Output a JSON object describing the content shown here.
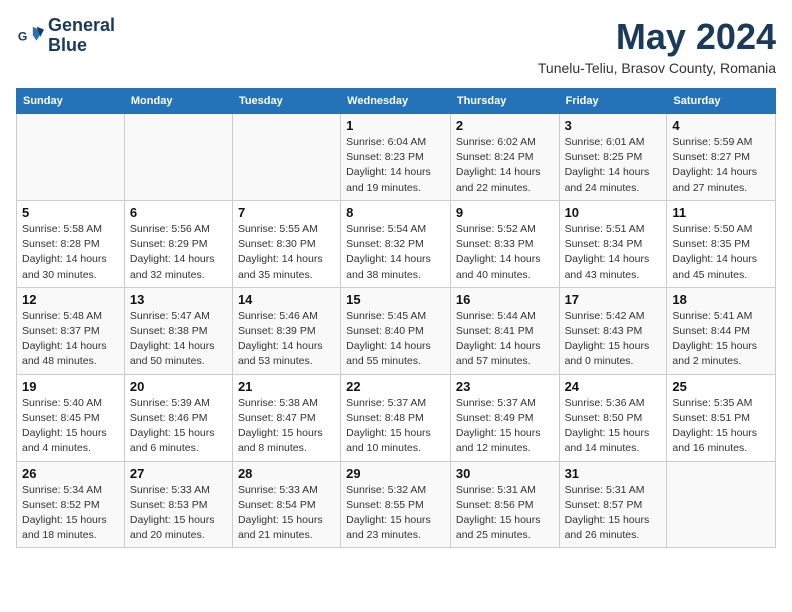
{
  "header": {
    "logo_line1": "General",
    "logo_line2": "Blue",
    "month": "May 2024",
    "location": "Tunelu-Teliu, Brasov County, Romania"
  },
  "weekdays": [
    "Sunday",
    "Monday",
    "Tuesday",
    "Wednesday",
    "Thursday",
    "Friday",
    "Saturday"
  ],
  "weeks": [
    [
      {
        "day": "",
        "info": ""
      },
      {
        "day": "",
        "info": ""
      },
      {
        "day": "",
        "info": ""
      },
      {
        "day": "1",
        "info": "Sunrise: 6:04 AM\nSunset: 8:23 PM\nDaylight: 14 hours\nand 19 minutes."
      },
      {
        "day": "2",
        "info": "Sunrise: 6:02 AM\nSunset: 8:24 PM\nDaylight: 14 hours\nand 22 minutes."
      },
      {
        "day": "3",
        "info": "Sunrise: 6:01 AM\nSunset: 8:25 PM\nDaylight: 14 hours\nand 24 minutes."
      },
      {
        "day": "4",
        "info": "Sunrise: 5:59 AM\nSunset: 8:27 PM\nDaylight: 14 hours\nand 27 minutes."
      }
    ],
    [
      {
        "day": "5",
        "info": "Sunrise: 5:58 AM\nSunset: 8:28 PM\nDaylight: 14 hours\nand 30 minutes."
      },
      {
        "day": "6",
        "info": "Sunrise: 5:56 AM\nSunset: 8:29 PM\nDaylight: 14 hours\nand 32 minutes."
      },
      {
        "day": "7",
        "info": "Sunrise: 5:55 AM\nSunset: 8:30 PM\nDaylight: 14 hours\nand 35 minutes."
      },
      {
        "day": "8",
        "info": "Sunrise: 5:54 AM\nSunset: 8:32 PM\nDaylight: 14 hours\nand 38 minutes."
      },
      {
        "day": "9",
        "info": "Sunrise: 5:52 AM\nSunset: 8:33 PM\nDaylight: 14 hours\nand 40 minutes."
      },
      {
        "day": "10",
        "info": "Sunrise: 5:51 AM\nSunset: 8:34 PM\nDaylight: 14 hours\nand 43 minutes."
      },
      {
        "day": "11",
        "info": "Sunrise: 5:50 AM\nSunset: 8:35 PM\nDaylight: 14 hours\nand 45 minutes."
      }
    ],
    [
      {
        "day": "12",
        "info": "Sunrise: 5:48 AM\nSunset: 8:37 PM\nDaylight: 14 hours\nand 48 minutes."
      },
      {
        "day": "13",
        "info": "Sunrise: 5:47 AM\nSunset: 8:38 PM\nDaylight: 14 hours\nand 50 minutes."
      },
      {
        "day": "14",
        "info": "Sunrise: 5:46 AM\nSunset: 8:39 PM\nDaylight: 14 hours\nand 53 minutes."
      },
      {
        "day": "15",
        "info": "Sunrise: 5:45 AM\nSunset: 8:40 PM\nDaylight: 14 hours\nand 55 minutes."
      },
      {
        "day": "16",
        "info": "Sunrise: 5:44 AM\nSunset: 8:41 PM\nDaylight: 14 hours\nand 57 minutes."
      },
      {
        "day": "17",
        "info": "Sunrise: 5:42 AM\nSunset: 8:43 PM\nDaylight: 15 hours\nand 0 minutes."
      },
      {
        "day": "18",
        "info": "Sunrise: 5:41 AM\nSunset: 8:44 PM\nDaylight: 15 hours\nand 2 minutes."
      }
    ],
    [
      {
        "day": "19",
        "info": "Sunrise: 5:40 AM\nSunset: 8:45 PM\nDaylight: 15 hours\nand 4 minutes."
      },
      {
        "day": "20",
        "info": "Sunrise: 5:39 AM\nSunset: 8:46 PM\nDaylight: 15 hours\nand 6 minutes."
      },
      {
        "day": "21",
        "info": "Sunrise: 5:38 AM\nSunset: 8:47 PM\nDaylight: 15 hours\nand 8 minutes."
      },
      {
        "day": "22",
        "info": "Sunrise: 5:37 AM\nSunset: 8:48 PM\nDaylight: 15 hours\nand 10 minutes."
      },
      {
        "day": "23",
        "info": "Sunrise: 5:37 AM\nSunset: 8:49 PM\nDaylight: 15 hours\nand 12 minutes."
      },
      {
        "day": "24",
        "info": "Sunrise: 5:36 AM\nSunset: 8:50 PM\nDaylight: 15 hours\nand 14 minutes."
      },
      {
        "day": "25",
        "info": "Sunrise: 5:35 AM\nSunset: 8:51 PM\nDaylight: 15 hours\nand 16 minutes."
      }
    ],
    [
      {
        "day": "26",
        "info": "Sunrise: 5:34 AM\nSunset: 8:52 PM\nDaylight: 15 hours\nand 18 minutes."
      },
      {
        "day": "27",
        "info": "Sunrise: 5:33 AM\nSunset: 8:53 PM\nDaylight: 15 hours\nand 20 minutes."
      },
      {
        "day": "28",
        "info": "Sunrise: 5:33 AM\nSunset: 8:54 PM\nDaylight: 15 hours\nand 21 minutes."
      },
      {
        "day": "29",
        "info": "Sunrise: 5:32 AM\nSunset: 8:55 PM\nDaylight: 15 hours\nand 23 minutes."
      },
      {
        "day": "30",
        "info": "Sunrise: 5:31 AM\nSunset: 8:56 PM\nDaylight: 15 hours\nand 25 minutes."
      },
      {
        "day": "31",
        "info": "Sunrise: 5:31 AM\nSunset: 8:57 PM\nDaylight: 15 hours\nand 26 minutes."
      },
      {
        "day": "",
        "info": ""
      }
    ]
  ]
}
